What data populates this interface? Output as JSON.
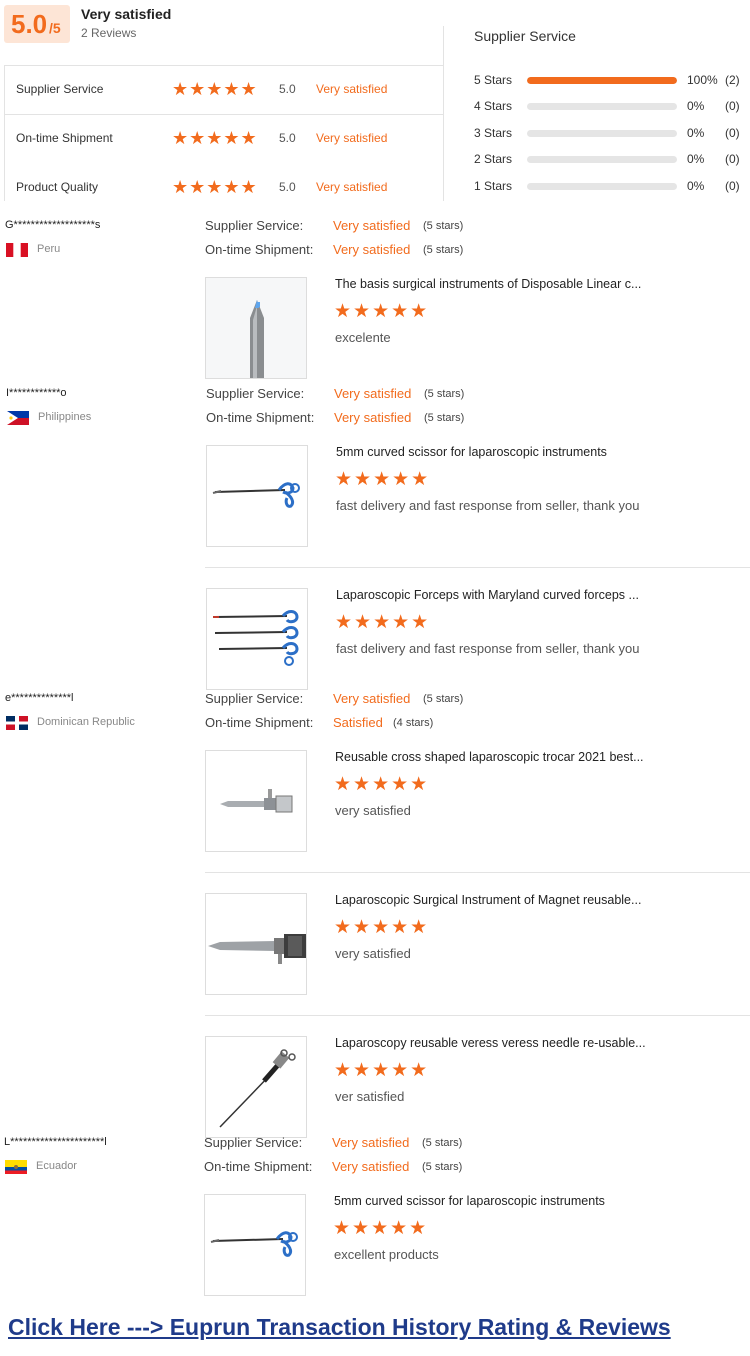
{
  "summary": {
    "score": "5.0",
    "score_max": "/5",
    "satisfaction": "Very satisfied",
    "review_count": "2 Reviews",
    "categories": [
      {
        "label": "Supplier Service",
        "rating": "5.0",
        "satisfaction": "Very satisfied",
        "stars": 5
      },
      {
        "label": "On-time Shipment",
        "rating": "5.0",
        "satisfaction": "Very satisfied",
        "stars": 5
      },
      {
        "label": "Product Quality",
        "rating": "5.0",
        "satisfaction": "Very satisfied",
        "stars": 5
      }
    ],
    "distribution_title": "Supplier Service",
    "distribution": [
      {
        "label": "5 Stars",
        "percent": "100%",
        "count": "(2)",
        "fraction": 1.0
      },
      {
        "label": "4 Stars",
        "percent": "0%",
        "count": "(0)",
        "fraction": 0
      },
      {
        "label": "3 Stars",
        "percent": "0%",
        "count": "(0)",
        "fraction": 0
      },
      {
        "label": "2 Stars",
        "percent": "0%",
        "count": "(0)",
        "fraction": 0
      },
      {
        "label": "1 Stars",
        "percent": "0%",
        "count": "(0)",
        "fraction": 0
      }
    ]
  },
  "star_glyph": "★★★★★",
  "reviews": [
    {
      "user": "G*******************s",
      "country": "Peru",
      "supplier_label": "Supplier Service:",
      "supplier_value": "Very satisfied",
      "supplier_stars": "(5 stars)",
      "shipment_label": "On-time Shipment:",
      "shipment_value": "Very satisfied",
      "shipment_stars": "(5 stars)",
      "products": [
        {
          "name": "The basis surgical instruments of Disposable Linear c...",
          "text": "excelente",
          "image": "stapler-tip-image"
        }
      ]
    },
    {
      "user": "I************o",
      "country": "Philippines",
      "supplier_label": "Supplier Service:",
      "supplier_value": "Very satisfied",
      "supplier_stars": "(5 stars)",
      "shipment_label": "On-time Shipment:",
      "shipment_value": "Very satisfied",
      "shipment_stars": "(5 stars)",
      "products": [
        {
          "name": "5mm curved scissor for laparoscopic instruments",
          "text": "fast delivery and fast response from seller, thank you",
          "image": "scissor-image"
        },
        {
          "name": "Laparoscopic Forceps with Maryland curved forceps ...",
          "text": "fast delivery and fast response from seller, thank you",
          "image": "forceps-image"
        }
      ]
    },
    {
      "user": "e**************l",
      "country": "Dominican Republic",
      "supplier_label": "Supplier Service:",
      "supplier_value": "Very satisfied",
      "supplier_stars": "(5 stars)",
      "shipment_label": "On-time Shipment:",
      "shipment_value": "Satisfied",
      "shipment_stars": "(4 stars)",
      "products": [
        {
          "name": "Reusable cross shaped laparoscopic trocar 2021 best...",
          "text": "very satisfied",
          "image": "trocar-image"
        },
        {
          "name": "Laparoscopic Surgical Instrument of Magnet reusable...",
          "text": "very satisfied",
          "image": "magnet-trocar-image"
        },
        {
          "name": "Laparoscopy reusable veress veress needle re-usable...",
          "text": "ver satisfied",
          "image": "veress-needle-image"
        }
      ]
    },
    {
      "user": "L**********************l",
      "country": "Ecuador",
      "supplier_label": "Supplier Service:",
      "supplier_value": "Very satisfied",
      "supplier_stars": "(5 stars)",
      "shipment_label": "On-time Shipment:",
      "shipment_value": "Very satisfied",
      "shipment_stars": "(5 stars)",
      "products": [
        {
          "name": "5mm curved scissor for laparoscopic instruments",
          "text": "excellent products",
          "image": "scissor-image"
        }
      ]
    }
  ],
  "footer_link": "Click Here ---> Euprun Transaction History Rating & Reviews",
  "colors": {
    "accent": "#f26b1d",
    "link": "#1f3b8a",
    "score_bg": "#fde5d6"
  }
}
